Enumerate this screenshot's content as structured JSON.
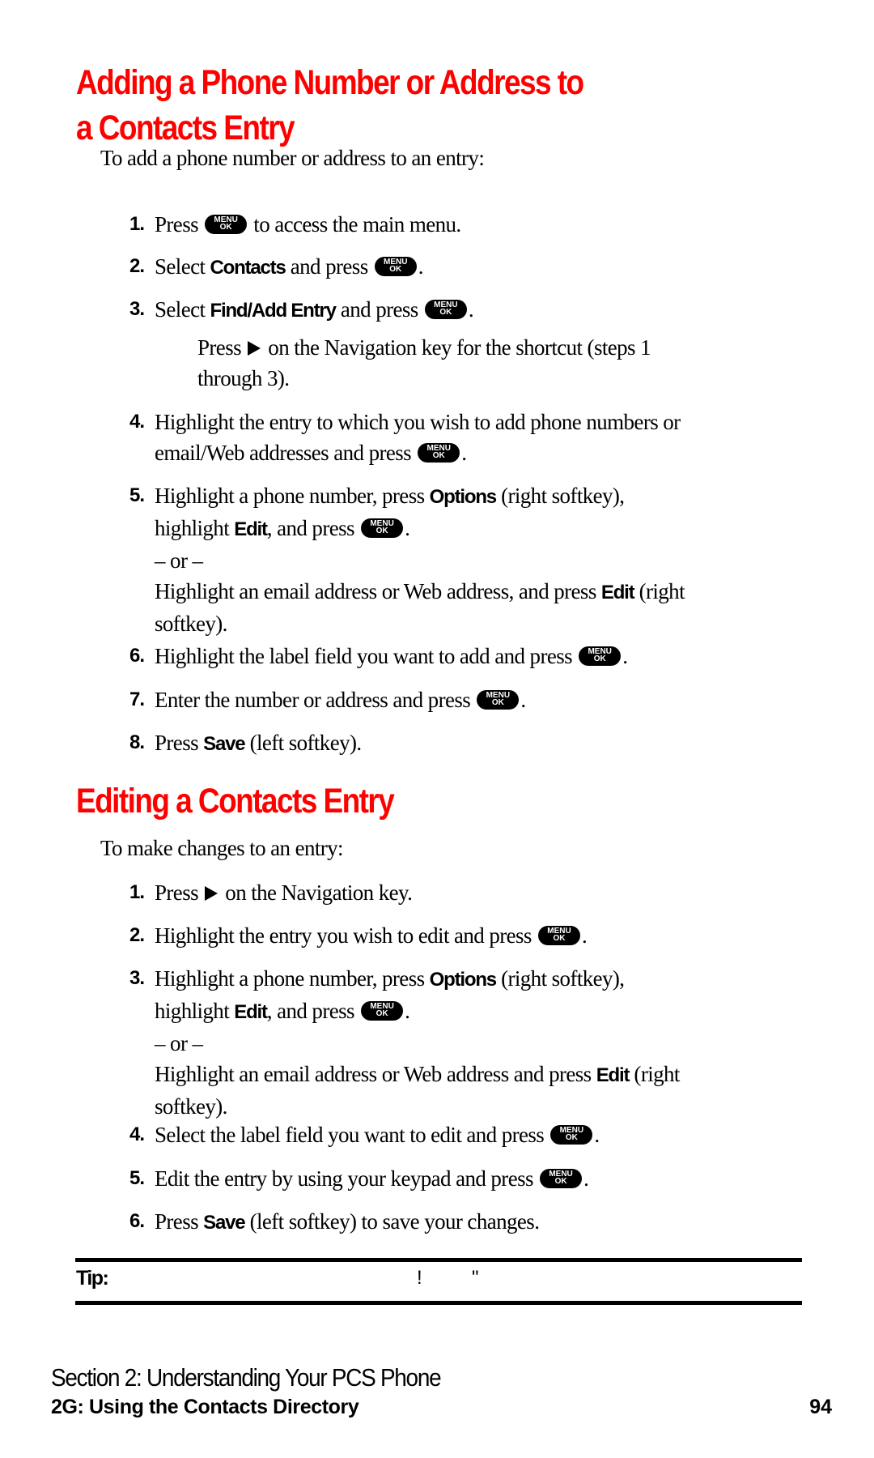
{
  "section1": {
    "heading_line1": "Adding a Phone Number or Address to",
    "heading_line2": "a Contacts Entry",
    "intro": "To add a phone number or address to an entry:",
    "steps": [
      {
        "num": "1.",
        "a": "Press ",
        "b": " to access the main menu."
      },
      {
        "num": "2.",
        "a": "Select ",
        "bold1": "Contacts",
        "b": " and press ",
        "c": "."
      },
      {
        "num": "3.",
        "a": "Select ",
        "bold1": "Find/Add Entry",
        "b": " and press ",
        "c": "."
      },
      {
        "num": "4.",
        "line1": "Highlight the entry to which you wish to add phone numbers or",
        "line2a": "email/Web addresses and press ",
        "line2b": "."
      },
      {
        "num": "5.",
        "line1a": "Highlight a phone number, press ",
        "line1bold": "Options",
        "line1b": " (right softkey),",
        "line2a": "highlight ",
        "line2bold": "Edit",
        "line2b": ", and press ",
        "line2c": ".",
        "or": "– or –",
        "line4a": "Highlight an email address or Web address, and press ",
        "line4bold": "Edit",
        "line4b": " (right",
        "line5": "softkey)."
      },
      {
        "num": "6.",
        "a": "Highlight the label field you want to add and press ",
        "c": "."
      },
      {
        "num": "7.",
        "a": "Enter the number or address and press ",
        "c": "."
      },
      {
        "num": "8.",
        "a": "Press ",
        "bold1": "Save",
        "b": " (left softkey)."
      }
    ],
    "shortcut_note": {
      "a": "Press ",
      "b": " on the Navigation key for the shortcut (steps 1",
      "line2": "through 3)."
    }
  },
  "section2": {
    "heading": "Editing a Contacts Entry",
    "intro": "To make changes to an entry:",
    "steps": [
      {
        "num": "1.",
        "a": "Press ",
        "b": " on the Navigation key."
      },
      {
        "num": "2.",
        "a": "Highlight the entry you wish to edit and press ",
        "c": "."
      },
      {
        "num": "3.",
        "line1a": "Highlight a phone number, press ",
        "line1bold": "Options",
        "line1b": " (right softkey),",
        "line2a": "highlight ",
        "line2bold": "Edit",
        "line2b": ", and press ",
        "line2c": ".",
        "or": "– or –",
        "line4a": "Highlight an email address or Web address and press ",
        "line4bold": "Edit",
        "line4b": " (right",
        "line5": "softkey)."
      },
      {
        "num": "4.",
        "a": "Select the label field you want to edit and press ",
        "c": "."
      },
      {
        "num": "5.",
        "a": "Edit the entry by using your keypad and press ",
        "c": "."
      },
      {
        "num": "6.",
        "a": "Press ",
        "bold1": "Save",
        "b": " (left softkey) to save your changes."
      }
    ]
  },
  "menu_key": {
    "line1": "MENU",
    "line2": "OK",
    "icon": "menu-ok-key-icon"
  },
  "nav_icon": "navigation-right-arrow-icon",
  "tip": {
    "label": "Tip:",
    "glyph1": "!",
    "glyph2": "\""
  },
  "footer": {
    "section": "Section 2: Understanding Your PCS Phone",
    "chapter": "2G: Using the Contacts Directory",
    "page": "94"
  },
  "colors": {
    "heading": "#ff0000",
    "text": "#000000"
  }
}
